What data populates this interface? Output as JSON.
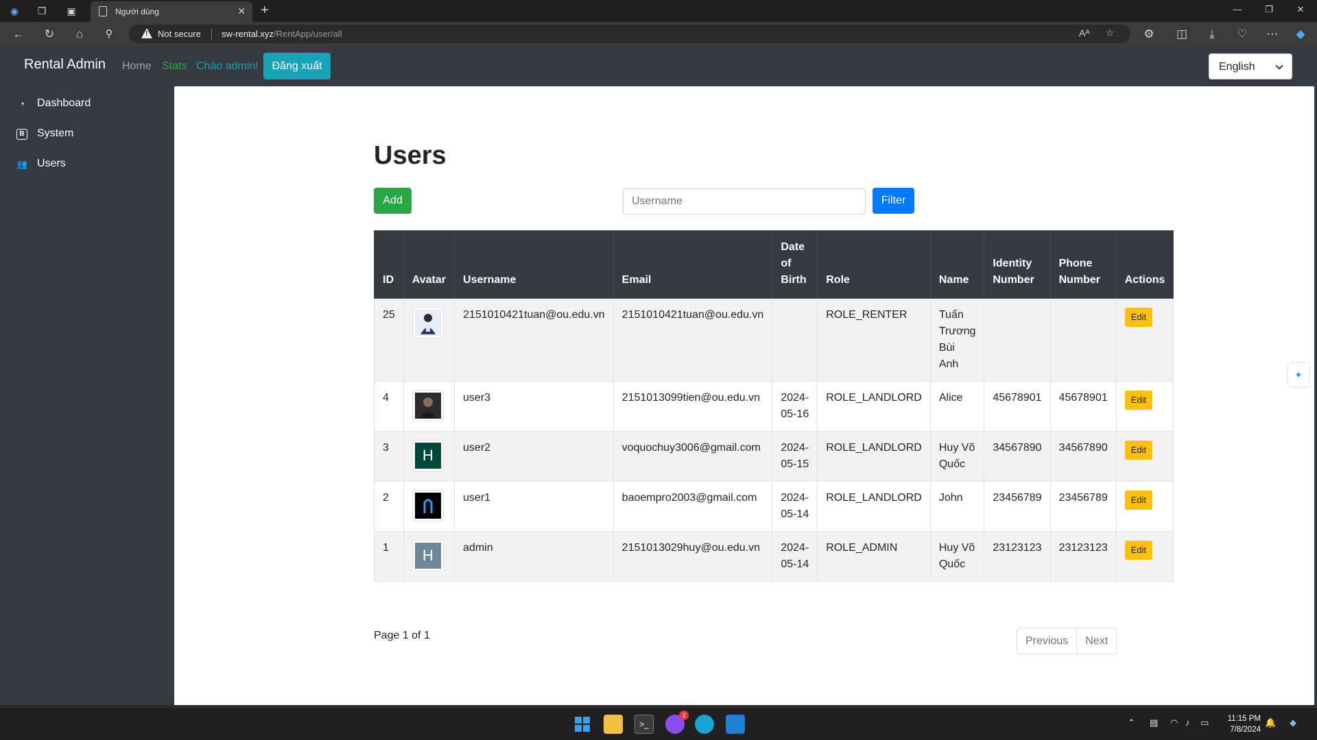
{
  "browser": {
    "tab_title": "Người dùng",
    "security_label": "Not secure",
    "url_host": "sw-rental.xyz",
    "url_path": "/RentApp/user/all"
  },
  "navbar": {
    "brand": "Rental Admin",
    "links": [
      {
        "label": "Home",
        "color": "#9ba2a8"
      },
      {
        "label": "Stats",
        "color": "#28a745"
      },
      {
        "label": "Chào admin!",
        "color": "#17a2b8"
      }
    ],
    "logout_label": "Đăng xuất",
    "language": "English"
  },
  "sidebar": {
    "items": [
      {
        "label": "Dashboard",
        "icon": "dashboard-gauge-icon"
      },
      {
        "label": "System",
        "icon": "system-b-icon"
      },
      {
        "label": "Users",
        "icon": "users-icon"
      }
    ]
  },
  "main": {
    "title": "Users",
    "add_label": "Add",
    "search_placeholder": "Username",
    "filter_label": "Filter",
    "columns": [
      "ID",
      "Avatar",
      "Username",
      "Email",
      "Date of Birth",
      "Role",
      "Name",
      "Identity Number",
      "Phone Number",
      "Actions"
    ],
    "rows": [
      {
        "id": "25",
        "avatar": {
          "icon": "person-photo-avatar",
          "bg": "#e9eef5",
          "letter": ""
        },
        "username": "2151010421tuan@ou.edu.vn",
        "email": "2151010421tuan@ou.edu.vn",
        "dob": "",
        "role": "ROLE_RENTER",
        "name": "Tuấn Trương Bùi Anh",
        "identity": "",
        "phone": "",
        "action": "Edit"
      },
      {
        "id": "4",
        "avatar": {
          "icon": "dark-photo-avatar",
          "bg": "#2b2b2b",
          "letter": ""
        },
        "username": "user3",
        "email": "2151013099tien@ou.edu.vn",
        "dob": "2024-05-16",
        "role": "ROLE_LANDLORD",
        "name": "Alice",
        "identity": "45678901",
        "phone": "45678901",
        "action": "Edit"
      },
      {
        "id": "3",
        "avatar": {
          "icon": "letter-avatar",
          "bg": "#00473c",
          "letter": "H"
        },
        "username": "user2",
        "email": "voquochuy3006@gmail.com",
        "dob": "2024-05-15",
        "role": "ROLE_LANDLORD",
        "name": "Huy Võ Quốc",
        "identity": "34567890",
        "phone": "34567890",
        "action": "Edit"
      },
      {
        "id": "2",
        "avatar": {
          "icon": "logo-avatar",
          "bg": "#000000",
          "letter": ""
        },
        "username": "user1",
        "email": "baoempro2003@gmail.com",
        "dob": "2024-05-14",
        "role": "ROLE_LANDLORD",
        "name": "John",
        "identity": "23456789",
        "phone": "23456789",
        "action": "Edit"
      },
      {
        "id": "1",
        "avatar": {
          "icon": "letter-avatar",
          "bg": "#6b8799",
          "letter": "H"
        },
        "username": "admin",
        "email": "2151013029huy@ou.edu.vn",
        "dob": "2024-05-14",
        "role": "ROLE_ADMIN",
        "name": "Huy Võ Quốc",
        "identity": "23123123",
        "phone": "23123123",
        "action": "Edit"
      }
    ],
    "page_info": "Page 1 of 1",
    "previous_label": "Previous",
    "next_label": "Next"
  },
  "taskbar": {
    "time": "11:15 PM",
    "date": "7/8/2024",
    "messenger_badge": "2"
  }
}
